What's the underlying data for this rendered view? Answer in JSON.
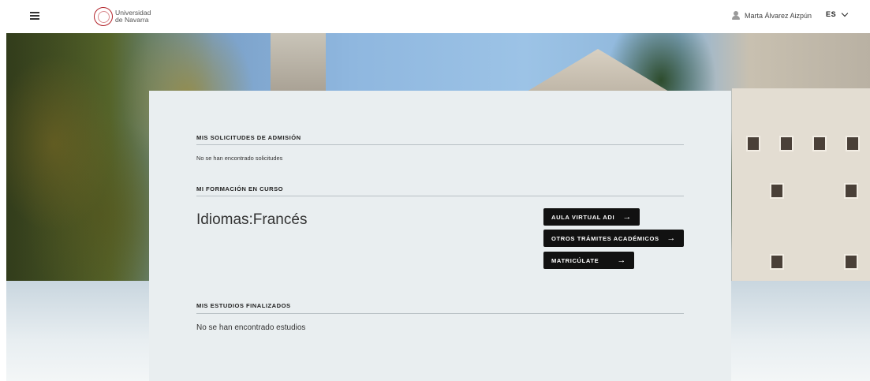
{
  "header": {
    "logo_line1": "Universidad",
    "logo_line2": "de Navarra",
    "user_name": "Marta Álvarez Aizpún",
    "language": "ES"
  },
  "sections": {
    "admissions": {
      "title": "MIS SOLICITUDES DE ADMISIÓN",
      "empty_text": "No se han encontrado solicitudes"
    },
    "current_training": {
      "title": "MI FORMACIÓN EN CURSO",
      "course_name": "Idiomas:Francés",
      "buttons": {
        "virtual_classroom": "AULA VIRTUAL ADI",
        "other_procedures": "OTROS TRÁMITES ACADÉMICOS",
        "enroll": "MATRICÚLATE"
      }
    },
    "finished_studies": {
      "title": "MIS ESTUDIOS FINALIZADOS",
      "empty_text": "No se han encontrado estudios"
    }
  },
  "icons": {
    "menu": "hamburger-menu-icon",
    "user": "user-icon",
    "language_chevron": "chevron-down-icon",
    "button_arrow": "arrow-right-icon"
  },
  "colors": {
    "brand_red": "#b2232a",
    "button_bg": "#111111",
    "panel_bg": "#e9eef0"
  }
}
